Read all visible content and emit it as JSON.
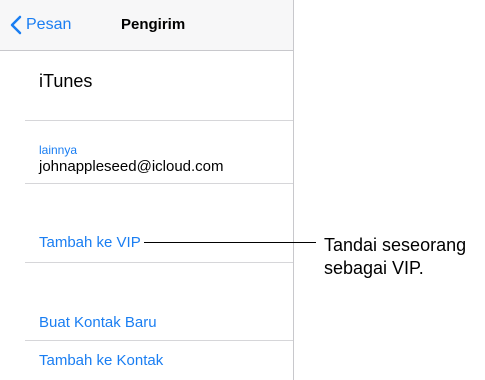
{
  "navbar": {
    "back_label": "Pesan",
    "title": "Pengirim"
  },
  "sender": {
    "name": "iTunes",
    "email_label": "lainnya",
    "email": "johnappleseed@icloud.com"
  },
  "actions": {
    "add_vip": "Tambah ke VIP",
    "new_contact": "Buat Kontak Baru",
    "add_contact": "Tambah ke Kontak"
  },
  "callout": {
    "line1": "Tandai seseorang",
    "line2": "sebagai VIP."
  },
  "colors": {
    "accent": "#1a7ef2"
  },
  "icons": {
    "back": "chevron-left-icon"
  }
}
